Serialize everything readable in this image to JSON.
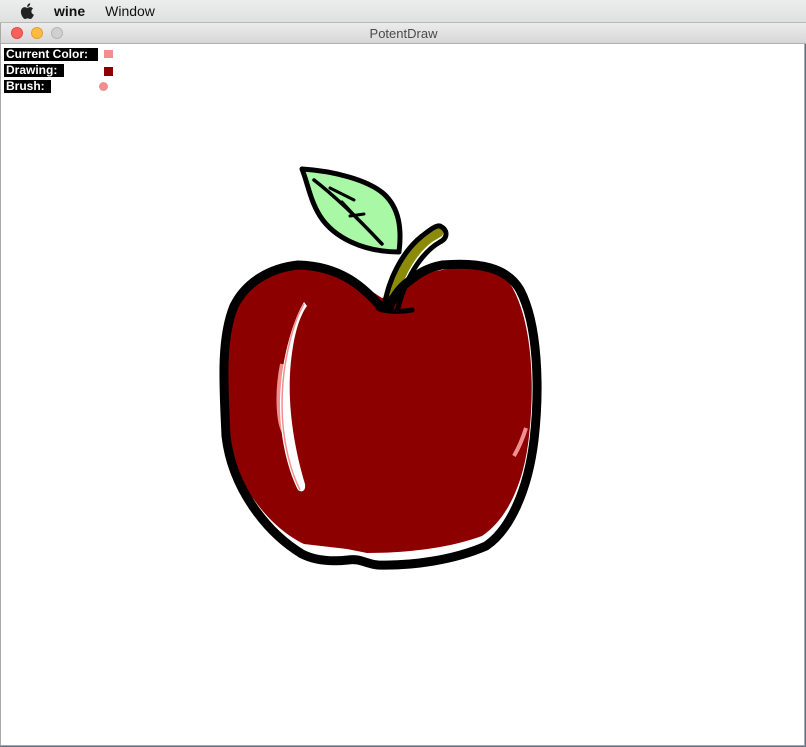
{
  "menubar": {
    "apple_icon": "apple-logo-icon",
    "app_name": "wine",
    "menus": [
      "Window"
    ]
  },
  "window": {
    "title": "PotentDraw",
    "controls": [
      "close-icon",
      "minimize-icon",
      "zoom-icon"
    ]
  },
  "hud": {
    "current_color_label": "Current Color:",
    "drawing_label": "Drawing:",
    "brush_label": "Brush:",
    "current_color": "#f08f8f",
    "drawing_color": "#8c0000",
    "brush_color": "#f08f8f"
  },
  "palette": {
    "apple_body": "#8c0000",
    "outline": "#000000",
    "leaf": "#a9f8a6",
    "stem": "#8c8a09",
    "highlight": "#ffffff",
    "highlight_edge": "#f08f8f"
  }
}
